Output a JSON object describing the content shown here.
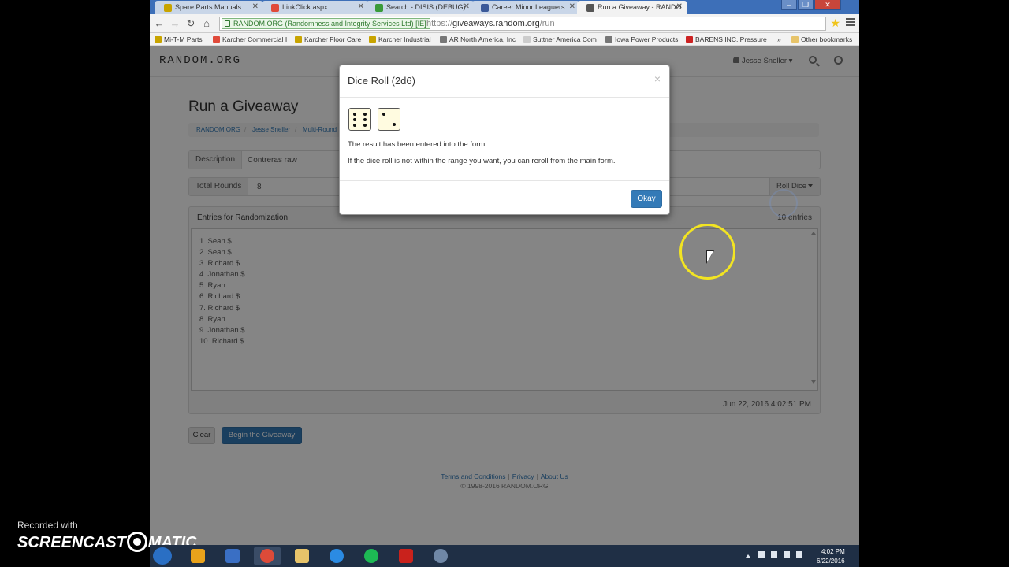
{
  "browser": {
    "tabs": [
      {
        "title": "Spare Parts Manuals",
        "color": "#c8a400"
      },
      {
        "title": "LinkClick.aspx",
        "color": "#e04a3a"
      },
      {
        "title": "Search - DISIS (DEBUG)",
        "color": "#3a9b3a"
      },
      {
        "title": "Career Minor Leaguers",
        "color": "#3b5998"
      },
      {
        "title": "Run a Giveaway - RANDO",
        "color": "#555555"
      }
    ],
    "ev_badge": "RANDOM.ORG (Randomness and Integrity Services Ltd) [IE]",
    "url_scheme": "https://",
    "url_host": "giveaways.random.org",
    "url_path": "/run",
    "bookmarks": [
      "Mi-T-M Parts",
      "Karcher Commercial I",
      "Karcher Floor Care",
      "Karcher Industrial",
      "AR North America, Inc",
      "Suttner America Com",
      "Iowa Power Products",
      "BARENS INC. Pressure",
      "»",
      "Other bookmarks"
    ]
  },
  "site": {
    "logo": "RANDOM.ORG",
    "user": "Jesse Sneller",
    "page_title": "Run a Giveaway",
    "breadcrumb": [
      "RANDOM.ORG",
      "Jesse Sneller",
      "Multi-Round"
    ],
    "description_label": "Description",
    "description_value": "Contreras raw",
    "rounds_label": "Total Rounds",
    "rounds_value": "8",
    "roll_dice_label": "Roll Dice",
    "entries_title": "Entries for Randomization",
    "entries_count": "10 entries",
    "entries": [
      "1. Sean $",
      "2. Sean $",
      "3. Richard $",
      "4. Jonathan $",
      "5. Ryan",
      "6. Richard $",
      "7. Richard $",
      "8. Ryan",
      "9. Jonathan $",
      "10. Richard $"
    ],
    "timestamp": "Jun 22, 2016 4:02:51 PM",
    "clear_label": "Clear",
    "begin_label": "Begin the Giveaway",
    "footer": {
      "terms": "Terms and Conditions",
      "privacy": "Privacy",
      "about": "About Us",
      "copyright": "© 1998-2016 RANDOM.ORG"
    }
  },
  "modal": {
    "title": "Dice Roll (2d6)",
    "close": "×",
    "dice": [
      6,
      2
    ],
    "line1": "The result has been entered into the form.",
    "line2": "If the dice roll is not within the range you want, you can reroll from the main form.",
    "okay": "Okay"
  },
  "watermark": {
    "label": "Recorded with",
    "brand_left": "SCREENCAST",
    "brand_right": "MATIC"
  },
  "taskbar": {
    "time": "4:02 PM",
    "date": "6/22/2016",
    "apps": [
      "outlook-icon",
      "outlook-tasks-icon",
      "chrome-icon",
      "file-explorer-icon",
      "internet-explorer-icon",
      "spotify-icon",
      "acrobat-icon",
      "screencast-icon"
    ],
    "app_colors": [
      "#e8a21b",
      "#3a6fc4",
      "#dd4b39",
      "#e7c46a",
      "#2b8be3",
      "#1db954",
      "#c9221c",
      "#6f87a6"
    ]
  },
  "colors": {
    "primary": "#337ab7",
    "cursor_highlight": "#f2e422",
    "die_face": "#fffbe0"
  }
}
